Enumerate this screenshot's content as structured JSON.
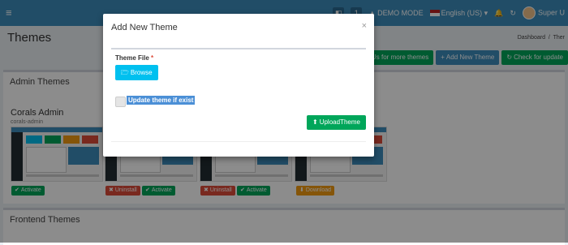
{
  "topbar": {
    "menu_icon": "hamburger-icon",
    "demo_mode": "DEMO MODE",
    "language": "English (US)",
    "user": "Super U",
    "counter": "1"
  },
  "page": {
    "title": "Themes",
    "breadcrumb_home": "Dashboard",
    "breadcrumb_current": "Ther"
  },
  "header_buttons": {
    "contact": "ntact Us for more themes",
    "add_new": "Add New Theme",
    "check_updates": "Check for update"
  },
  "admin_section": {
    "title": "Admin Themes",
    "theme_name": "Corals Admin",
    "theme_slug": "corals-admin"
  },
  "theme_actions": {
    "activate": "Activate",
    "uninstall": "Uninstall",
    "download": "Download"
  },
  "frontend_section": {
    "title": "Frontend Themes"
  },
  "modal": {
    "title": "Add New Theme",
    "close": "×",
    "field_label": "Theme File",
    "required_mark": "*",
    "browse": "Browse",
    "checkbox_label": "Update theme if exist",
    "upload": "UploadTheme"
  }
}
